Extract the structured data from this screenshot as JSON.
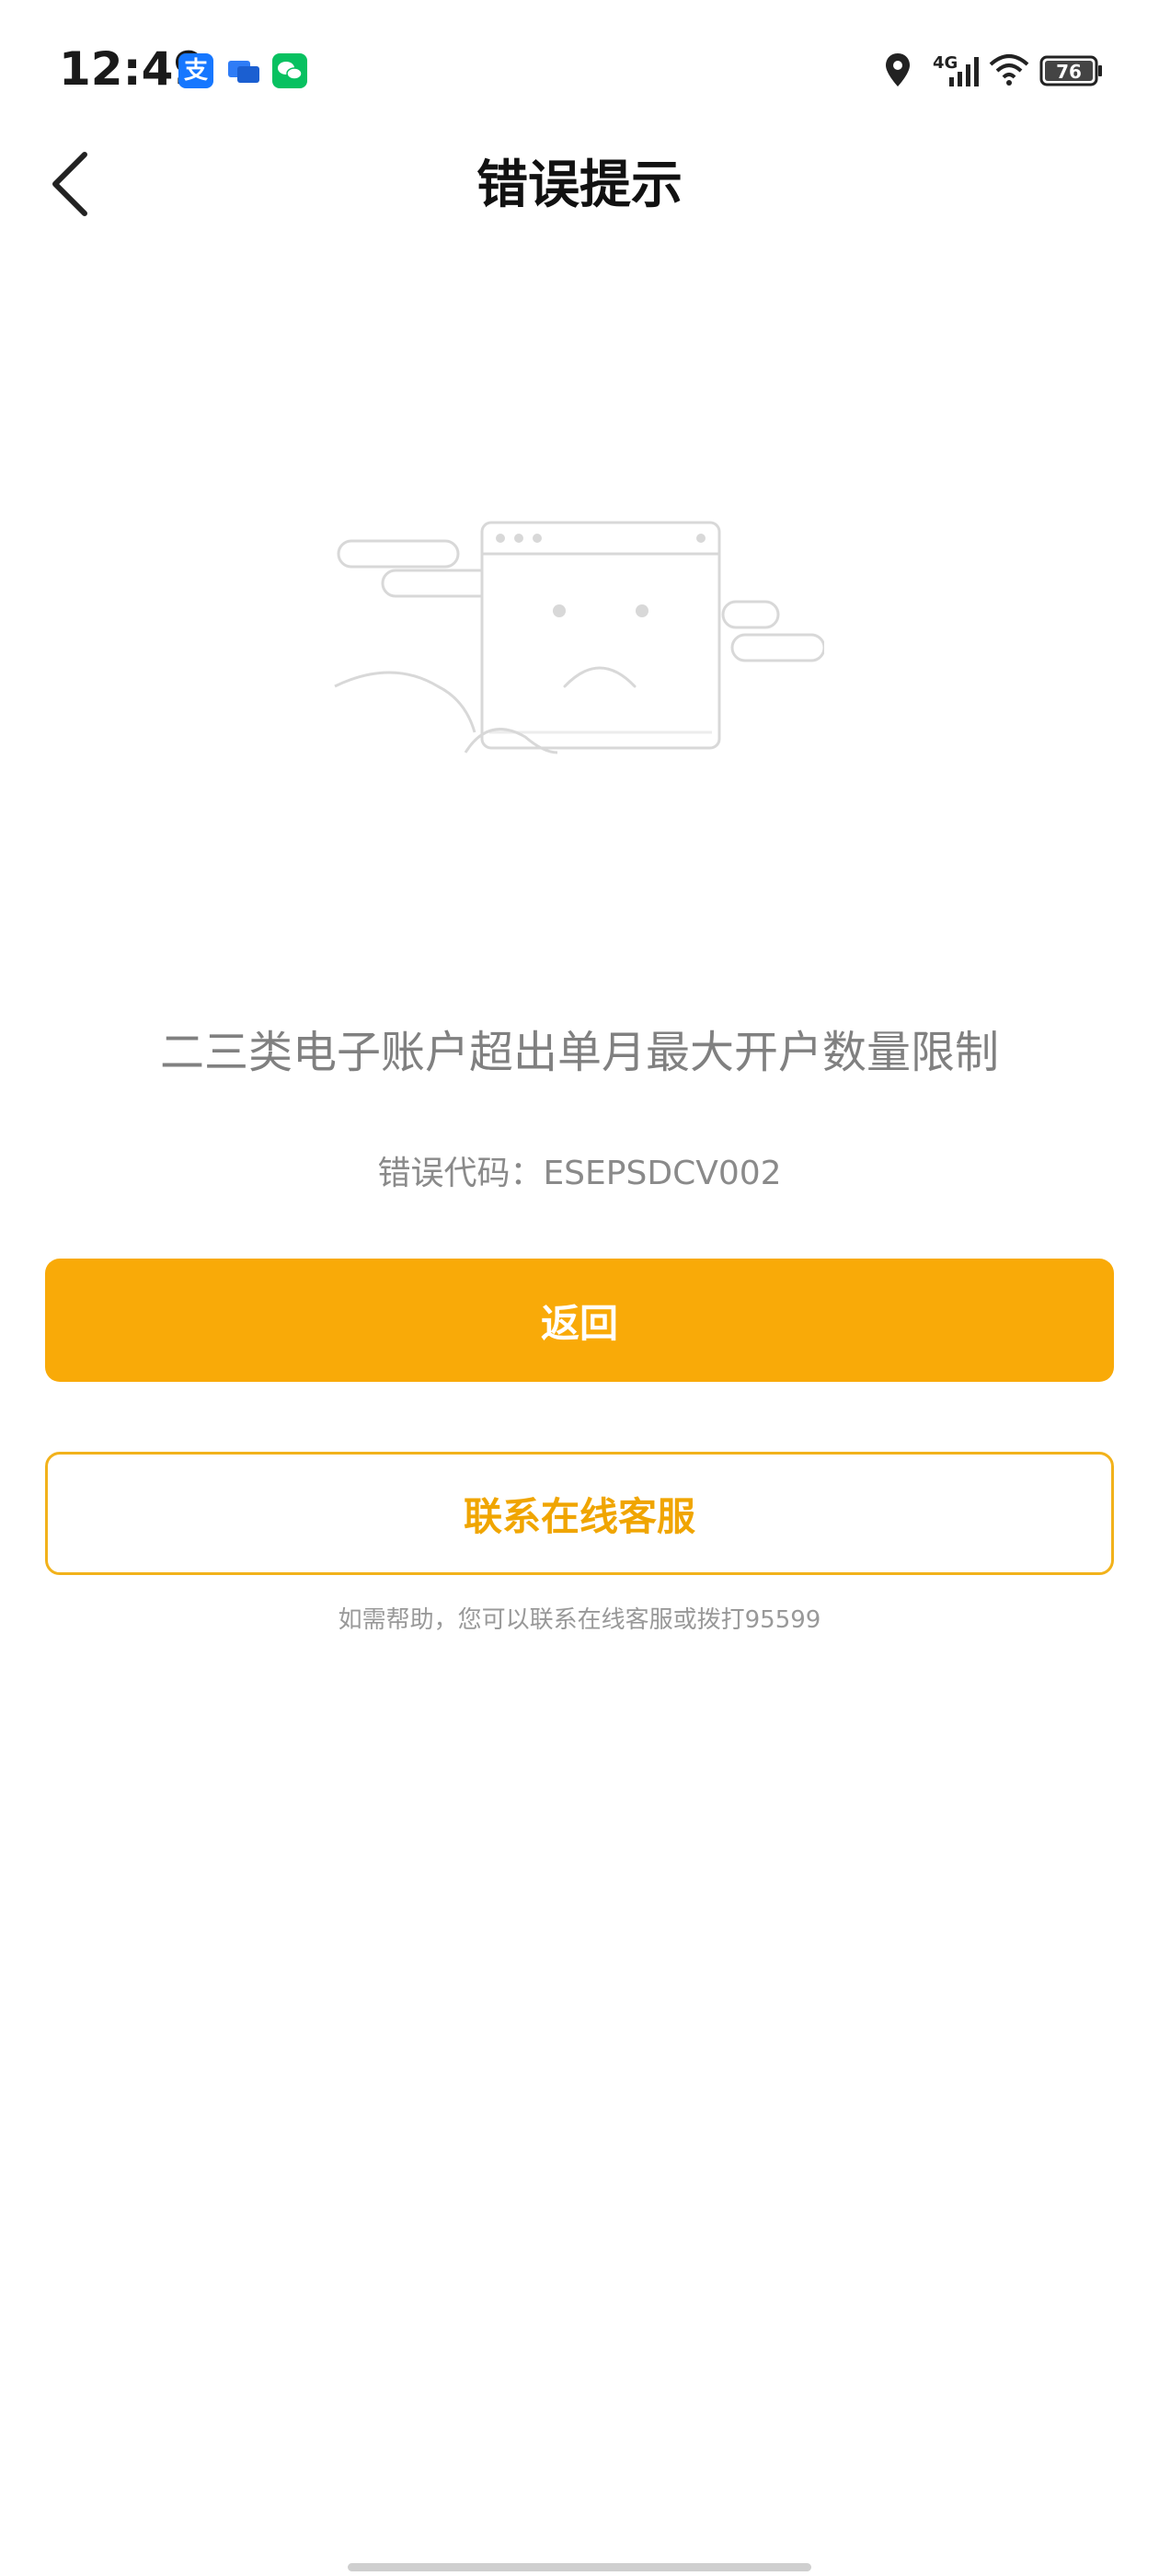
{
  "status_bar": {
    "time": "12:49",
    "alipay_glyph": "支",
    "battery_level": "76",
    "network": "4G",
    "notification_icons": [
      "alipay-icon",
      "message-icon",
      "wechat-icon"
    ],
    "system_icons": [
      "location-icon",
      "signal-icon",
      "wifi-icon",
      "battery-icon"
    ]
  },
  "nav": {
    "title": "错误提示",
    "back_icon": "chevron-left-icon"
  },
  "error": {
    "message": "二三类电子账户超出单月最大开户数量限制",
    "code_text": "错误代码：ESEPSDCV002"
  },
  "actions": {
    "back_label": "返回",
    "contact_label": "联系在线客服"
  },
  "help": {
    "text": "如需帮助，您可以联系在线客服或拨打95599"
  },
  "colors": {
    "accent": "#f9aa08",
    "outline": "#f2b21b",
    "text_gray": "#808080"
  }
}
